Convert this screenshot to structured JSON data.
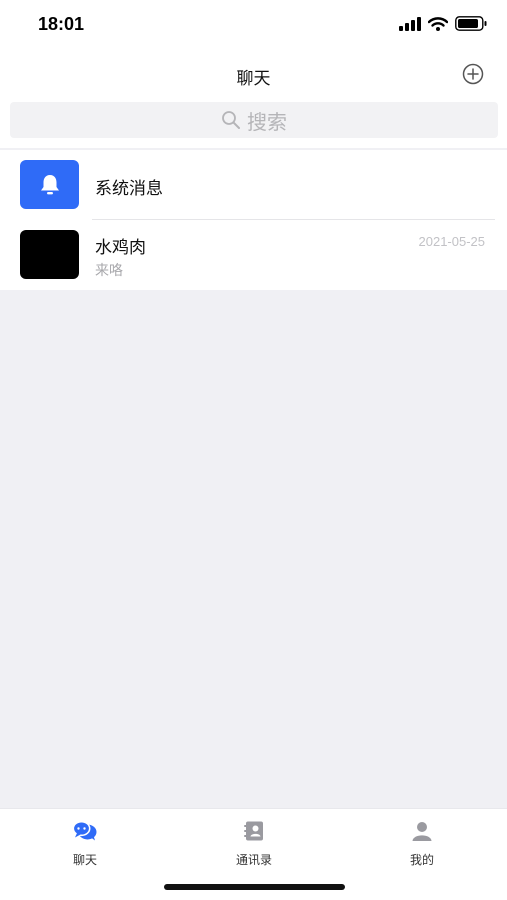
{
  "status_bar": {
    "time": "18:01"
  },
  "nav": {
    "title": "聊天",
    "add_icon": "plus-circle-icon"
  },
  "search": {
    "placeholder": "搜索",
    "icon": "search-icon"
  },
  "conversations": [
    {
      "name": "系统消息",
      "preview": "",
      "time": "",
      "avatar": "bell-icon",
      "avatar_color": "#2f6bf7"
    },
    {
      "name": "水鸡肉",
      "preview": "来咯",
      "time": "2021-05-25",
      "avatar": "black-avatar",
      "avatar_color": "#000000"
    }
  ],
  "tabbar": {
    "accent": "#2f6bf7",
    "items": [
      {
        "label": "聊天",
        "icon": "chat-bubbles-icon",
        "active": true
      },
      {
        "label": "通讯录",
        "icon": "contacts-book-icon",
        "active": false
      },
      {
        "label": "我的",
        "icon": "person-icon",
        "active": false
      }
    ]
  }
}
